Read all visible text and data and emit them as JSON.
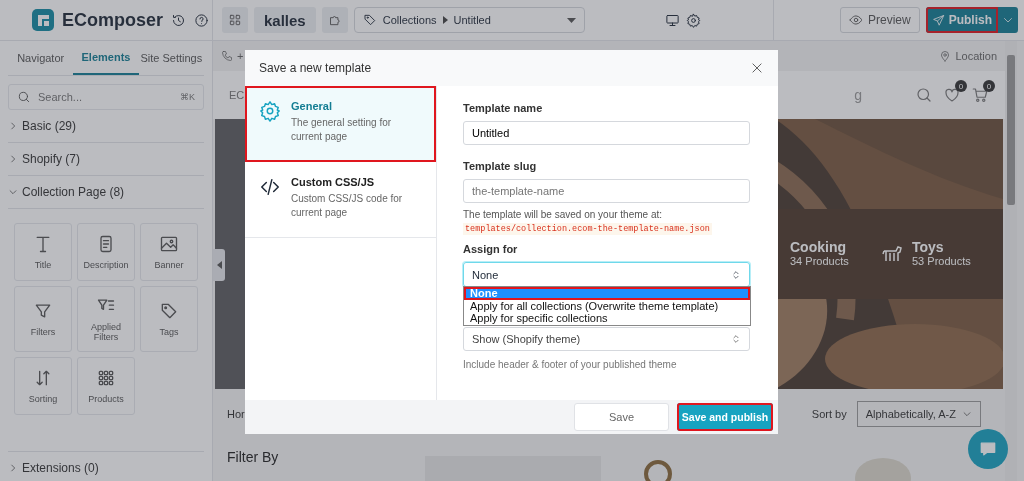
{
  "app": {
    "logo": "EComposer"
  },
  "toolbar": {
    "theme": "kalles",
    "breadcrumb": [
      "Collections",
      "Untitled"
    ],
    "preview": "Preview",
    "publish": {
      "label": "Publish",
      "highlighted": true
    }
  },
  "sidebar": {
    "tabs": [
      {
        "label": "Navigator",
        "selected": false
      },
      {
        "label": "Elements",
        "selected": true
      },
      {
        "label": "Site Settings",
        "selected": false
      }
    ],
    "search": {
      "placeholder": "Search...",
      "shortcut": "⌘K"
    },
    "groups": [
      {
        "label": "Basic (29)",
        "expanded": false
      },
      {
        "label": "Shopify (7)",
        "expanded": false
      },
      {
        "label": "Collection Page (8)",
        "expanded": true,
        "elements": [
          {
            "label": "Title"
          },
          {
            "label": "Description"
          },
          {
            "label": "Banner"
          },
          {
            "label": "Filters"
          },
          {
            "label": "Applied Filters"
          },
          {
            "label": "Tags"
          },
          {
            "label": "Sorting"
          },
          {
            "label": "Products"
          }
        ]
      },
      {
        "label": "Extensions (0)",
        "expanded": false
      }
    ]
  },
  "canvas": {
    "topbar": {
      "phone": "+",
      "location": "Location"
    },
    "header": {
      "brand": "EC",
      "nav_fragment": "g",
      "wishlist_count": "0",
      "cart_count": "0"
    },
    "hero": {
      "kind": "picture",
      "categories": [
        {
          "name": "Cooking",
          "count": "34 Products"
        },
        {
          "name": "Toys",
          "count": "53 Products"
        }
      ]
    },
    "breadcrumb": "Hor",
    "sort": {
      "label": "Sort by",
      "value": "Alphabetically, A-Z"
    },
    "filter_title": "Filter By"
  },
  "modal": {
    "title": "Save a new template",
    "sections": [
      {
        "title": "General",
        "description": "The general setting for current page",
        "selected": true,
        "highlighted": true
      },
      {
        "title": "Custom CSS/JS",
        "description": "Custom CSS/JS code for current page",
        "selected": false,
        "highlighted": false
      }
    ],
    "template_name": {
      "label": "Template name",
      "value": "Untitled"
    },
    "template_slug": {
      "label": "Template slug",
      "placeholder": "the-template-name",
      "hint": "The template will be saved on your theme at:",
      "path": "templates/collection.ecom-the-template-name.json"
    },
    "assign": {
      "label": "Assign for",
      "value": "None",
      "open": true,
      "options": [
        {
          "label": "None",
          "selected": true,
          "highlighted": true
        },
        {
          "label": "Apply for all collections (Overwrite theme template)",
          "selected": false,
          "highlighted": false
        },
        {
          "label": "Apply for specific collections",
          "selected": false,
          "highlighted": false
        }
      ]
    },
    "layout": {
      "value": "Show (Shopify theme)",
      "hint": "Include header & footer of your published theme"
    },
    "buttons": [
      {
        "label": "Save",
        "kind": "secondary",
        "highlighted": false
      },
      {
        "label": "Save and publish",
        "kind": "primary",
        "highlighted": true
      }
    ]
  }
}
